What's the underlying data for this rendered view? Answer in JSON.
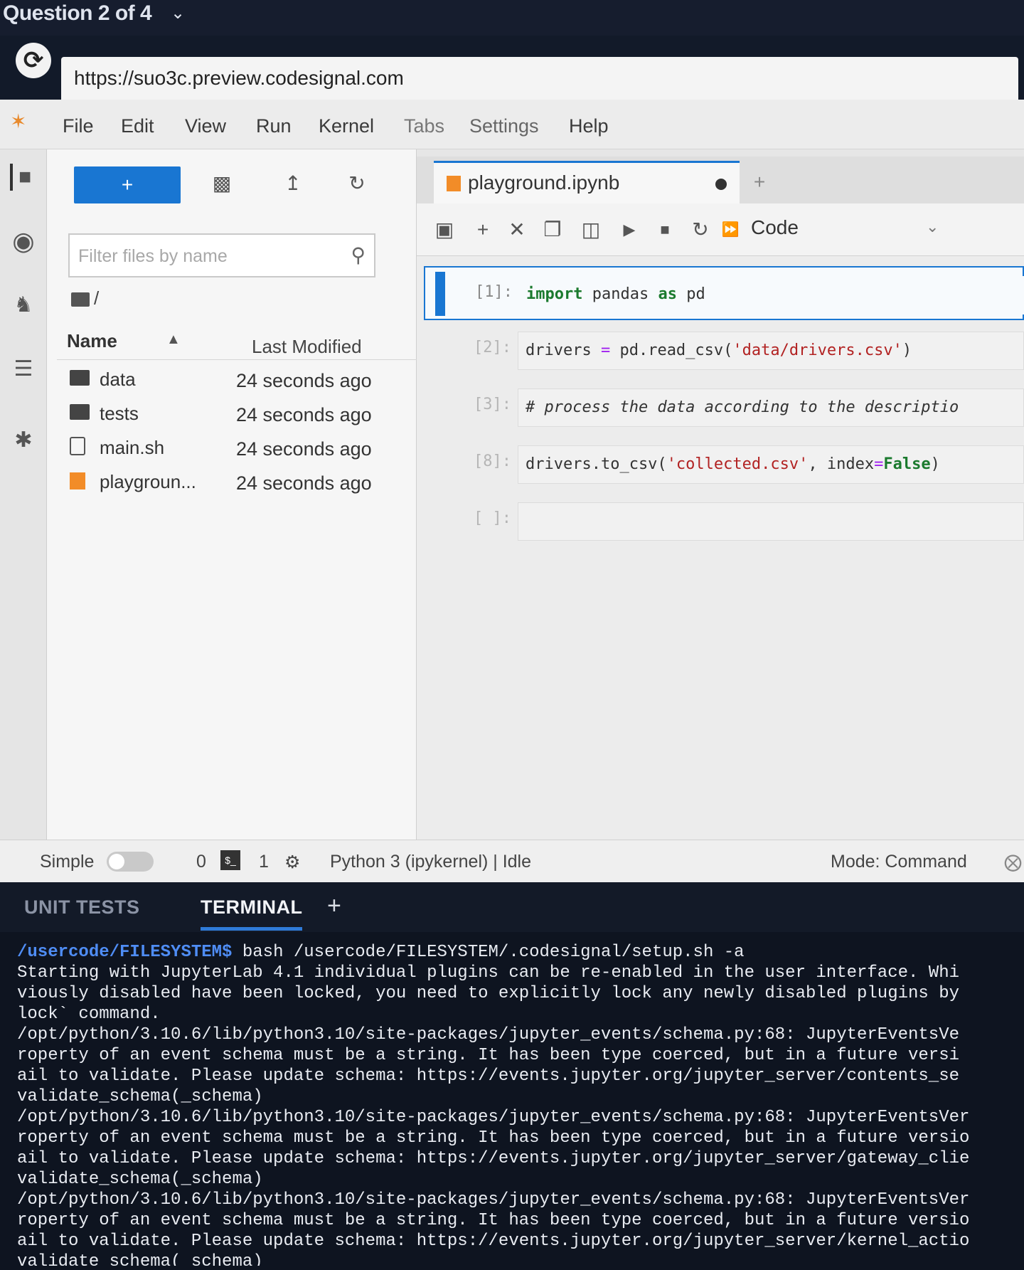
{
  "question_bar": {
    "title": "Question 2 of 4",
    "chevron_icon": "chevron-down-icon"
  },
  "browser": {
    "url": "https://suo3c.preview.codesignal.com",
    "reload_icon": "reload-icon"
  },
  "menu": [
    "File",
    "Edit",
    "View",
    "Run",
    "Kernel",
    "Tabs",
    "Settings",
    "Help"
  ],
  "file_browser": {
    "new_button_label": "+",
    "filter_placeholder": "Filter files by name",
    "breadcrumb": "/",
    "header_name": "Name",
    "header_modified": "Last Modified",
    "files": [
      {
        "name": "data",
        "type": "folder",
        "modified": "24 seconds ago"
      },
      {
        "name": "tests",
        "type": "folder",
        "modified": "24 seconds ago"
      },
      {
        "name": "main.sh",
        "type": "file",
        "modified": "24 seconds ago"
      },
      {
        "name": "playgroun...",
        "type": "notebook",
        "modified": "24 seconds ago"
      }
    ]
  },
  "notebook": {
    "tab_name": "playground.ipynb",
    "cell_type": "Code",
    "cells": [
      {
        "prompt": "[1]:",
        "code": "import pandas as pd"
      },
      {
        "prompt": "[2]:",
        "code": "drivers = pd.read_csv('data/drivers.csv')"
      },
      {
        "prompt": "[3]:",
        "code": "# process the data according to the descriptio"
      },
      {
        "prompt": "[8]:",
        "code": "drivers.to_csv('collected.csv', index=False)"
      },
      {
        "prompt": "[ ]:",
        "code": ""
      }
    ]
  },
  "status_bar": {
    "mode_simple": "Simple",
    "count_a": "0",
    "count_b": "1",
    "kernel": "Python 3 (ipykernel) | Idle",
    "mode": "Mode: Command"
  },
  "panel": {
    "tabs": [
      "UNIT TESTS",
      "TERMINAL"
    ],
    "add_label": "+",
    "prompt_path": "/usercode/FILESYSTEM$",
    "command": " bash /usercode/FILESYSTEM/.codesignal/setup.sh -a",
    "output": [
      "Starting with JupyterLab 4.1 individual plugins can be re-enabled in the user interface. Whi",
      "viously disabled have been locked, you need to explicitly lock any newly disabled plugins by",
      "lock` command.",
      "/opt/python/3.10.6/lib/python3.10/site-packages/jupyter_events/schema.py:68: JupyterEventsVe",
      "roperty of an event schema must be a string. It has been type coerced, but in a future versi",
      "ail to validate. Please update schema: https://events.jupyter.org/jupyter_server/contents_se",
      "  validate_schema(_schema)",
      "/opt/python/3.10.6/lib/python3.10/site-packages/jupyter_events/schema.py:68: JupyterEventsVer",
      "roperty of an event schema must be a string. It has been type coerced, but in a future versio",
      "ail to validate. Please update schema: https://events.jupyter.org/jupyter_server/gateway_clie",
      "  validate_schema(_schema)",
      "/opt/python/3.10.6/lib/python3.10/site-packages/jupyter_events/schema.py:68: JupyterEventsVer",
      "roperty of an event schema must be a string. It has been type coerced, but in a future versio",
      "ail to validate. Please update schema: https://events.jupyter.org/jupyter_server/kernel_actio",
      "  validate_schema(_schema)"
    ]
  }
}
